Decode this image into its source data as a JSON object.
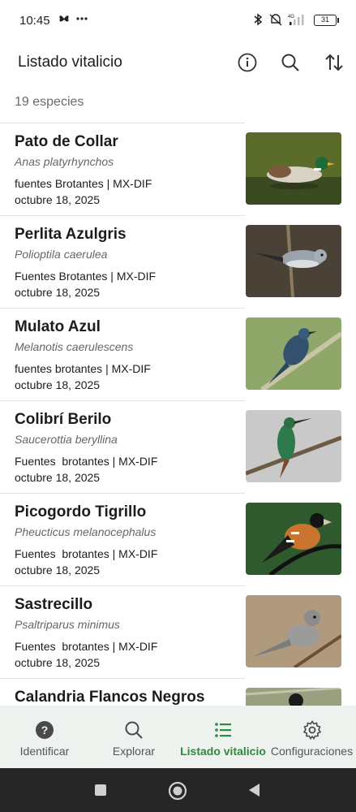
{
  "status_bar": {
    "time": "10:45",
    "battery": "31",
    "network": "4G"
  },
  "header": {
    "title": "Listado vitalicio",
    "icons": [
      "info-icon",
      "search-icon",
      "sort-icon"
    ]
  },
  "list": {
    "count_label": "19 especies",
    "items": [
      {
        "common": "Pato de Collar",
        "scientific": "Anas platyrhynchos",
        "source": "fuentes Brotantes | MX-DIF",
        "date": "octubre 18, 2025"
      },
      {
        "common": "Perlita Azulgris",
        "scientific": "Polioptila caerulea",
        "source": "Fuentes Brotantes | MX-DIF",
        "date": "octubre 18, 2025"
      },
      {
        "common": "Mulato Azul",
        "scientific": "Melanotis caerulescens",
        "source": "fuentes brotantes | MX-DIF",
        "date": "octubre 18, 2025"
      },
      {
        "common": "Colibrí Berilo",
        "scientific": "Saucerottia beryllina",
        "source": "Fuentes  brotantes | MX-DIF",
        "date": "octubre 18, 2025"
      },
      {
        "common": "Picogordo Tigrillo",
        "scientific": "Pheucticus melanocephalus",
        "source": "Fuentes  brotantes | MX-DIF",
        "date": "octubre 18, 2025"
      },
      {
        "common": "Sastrecillo",
        "scientific": "Psaltriparus minimus",
        "source": "Fuentes  brotantes | MX-DIF",
        "date": "octubre 18, 2025"
      },
      {
        "common": "Calandria Flancos Negros",
        "scientific": "",
        "source": "",
        "date": ""
      }
    ]
  },
  "bottom_nav": {
    "items": [
      {
        "label": "Identificar",
        "icon": "help-circle-icon"
      },
      {
        "label": "Explorar",
        "icon": "search-icon"
      },
      {
        "label": "Listado vitalicio",
        "icon": "list-icon",
        "active": true
      },
      {
        "label": "Configuraciones",
        "icon": "gear-icon"
      }
    ]
  },
  "colors": {
    "accent": "#2e8b3a",
    "nav_bg": "#eef2ee",
    "system_nav_bg": "#262626"
  }
}
